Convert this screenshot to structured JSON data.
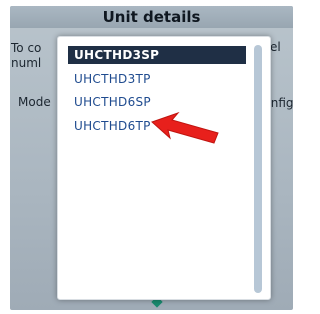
{
  "window": {
    "title": "Unit details"
  },
  "background": {
    "left_text_1": "To co",
    "left_text_2": "numl",
    "left_text_3": "Mode",
    "right_text_1": "odel",
    "right_text_2": "Config"
  },
  "model_list": {
    "items": [
      {
        "label": "UHCTHD3SP",
        "selected": true
      },
      {
        "label": "UHCTHD3TP",
        "selected": false
      },
      {
        "label": "UHCTHD6SP",
        "selected": false
      },
      {
        "label": "UHCTHD6TP",
        "selected": false
      }
    ]
  },
  "colors": {
    "selection_bg": "#1f2f45",
    "item_text": "#1f4b8f",
    "annotation_arrow": "#e8201c",
    "scrollbar": "#b7c7d6"
  },
  "icons": {
    "annotation": "red-arrow-icon"
  }
}
